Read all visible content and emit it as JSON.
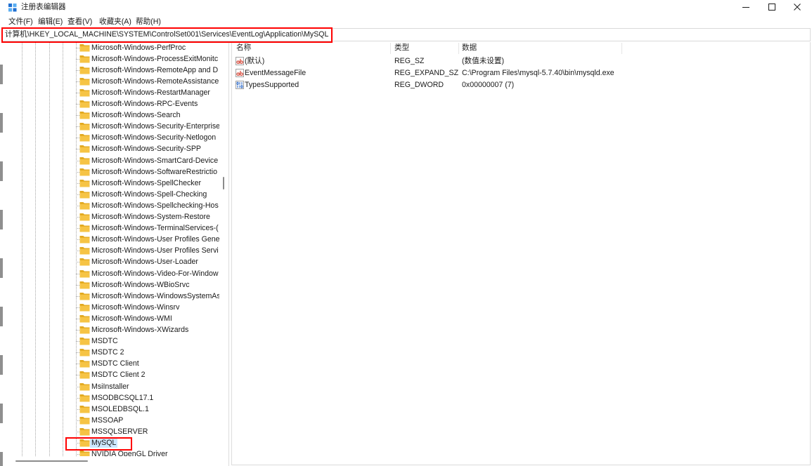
{
  "window": {
    "title": "注册表编辑器",
    "app_icon": "registry-editor-icon",
    "controls": {
      "minimize": "minimize-icon",
      "maximize": "maximize-icon",
      "close": "close-icon"
    }
  },
  "menu": {
    "file": "文件(F)",
    "edit": "编辑(E)",
    "view": "查看(V)",
    "favorites": "收藏夹(A)",
    "help": "帮助(H)"
  },
  "address": {
    "path": "计算机\\HKEY_LOCAL_MACHINE\\SYSTEM\\ControlSet001\\Services\\EventLog\\Application\\MySQL"
  },
  "tree": {
    "item_icon": "folder-icon",
    "selected_index": 35,
    "items": [
      "Microsoft-Windows-PerfProc",
      "Microsoft-Windows-ProcessExitMonitc",
      "Microsoft-Windows-RemoteApp and D",
      "Microsoft-Windows-RemoteAssistance",
      "Microsoft-Windows-RestartManager",
      "Microsoft-Windows-RPC-Events",
      "Microsoft-Windows-Search",
      "Microsoft-Windows-Security-Enterprise",
      "Microsoft-Windows-Security-Netlogon",
      "Microsoft-Windows-Security-SPP",
      "Microsoft-Windows-SmartCard-Device",
      "Microsoft-Windows-SoftwareRestrictio",
      "Microsoft-Windows-SpellChecker",
      "Microsoft-Windows-Spell-Checking",
      "Microsoft-Windows-Spellchecking-Hos",
      "Microsoft-Windows-System-Restore",
      "Microsoft-Windows-TerminalServices-(",
      "Microsoft-Windows-User Profiles Gene",
      "Microsoft-Windows-User Profiles Servi",
      "Microsoft-Windows-User-Loader",
      "Microsoft-Windows-Video-For-Window",
      "Microsoft-Windows-WBioSrvc",
      "Microsoft-Windows-WindowsSystemAs",
      "Microsoft-Windows-Winsrv",
      "Microsoft-Windows-WMI",
      "Microsoft-Windows-XWizards",
      "MSDTC",
      "MSDTC 2",
      "MSDTC Client",
      "MSDTC Client 2",
      "MsiInstaller",
      "MSODBCSQL17.1",
      "MSOLEDBSQL.1",
      "MSSOAP",
      "MSSQLSERVER",
      "MySQL",
      "NVIDIA OpenGL Driver"
    ]
  },
  "values": {
    "columns": {
      "name": "名称",
      "type": "类型",
      "data": "数据"
    },
    "rows": [
      {
        "icon": "reg-string-icon",
        "name": "(默认)",
        "type": "REG_SZ",
        "data": "(数值未设置)"
      },
      {
        "icon": "reg-string-icon",
        "name": "EventMessageFile",
        "type": "REG_EXPAND_SZ",
        "data": "C:\\Program Files\\mysql-5.7.40\\bin\\mysqld.exe"
      },
      {
        "icon": "reg-binary-icon",
        "name": "TypesSupported",
        "type": "REG_DWORD",
        "data": "0x00000007 (7)"
      }
    ]
  },
  "annotations": {
    "address_bar_boxed": true,
    "selected_tree_item_boxed": true
  },
  "colors": {
    "annotation": "#ff0000",
    "folder": "#f6c445",
    "folder_back": "#e2a91f",
    "selection": "#cce8ff",
    "string_icon": "#d23a2a",
    "binary_icon": "#1f5fc4"
  }
}
